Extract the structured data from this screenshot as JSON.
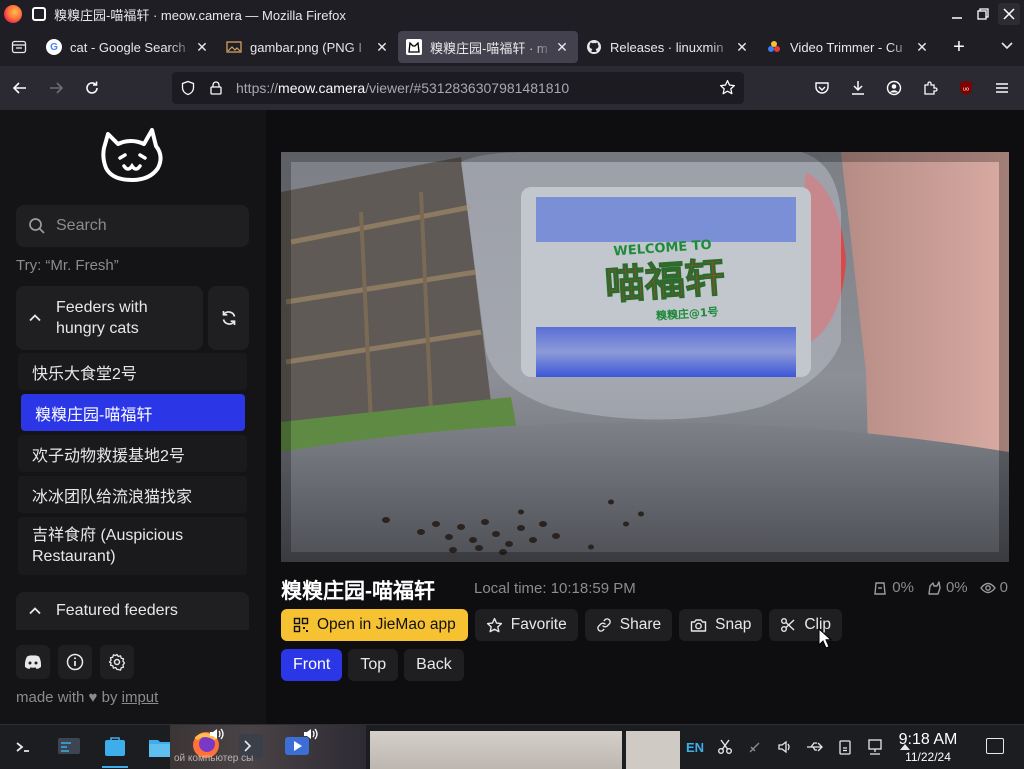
{
  "window": {
    "title": "糗糗庄园-喵福轩 · meow.camera — Mozilla Firefox"
  },
  "tabs": [
    {
      "label": "cat - Google Search",
      "favicon": "google-icon",
      "active": false
    },
    {
      "label": "gambar.png (PNG I",
      "favicon": "image-icon",
      "active": false
    },
    {
      "label": "糗糗庄园-喵福轩 · m",
      "favicon": "meow-camera-icon",
      "active": true
    },
    {
      "label": "Releases · linuxmin",
      "favicon": "github-icon",
      "active": false
    },
    {
      "label": "Video Trimmer - Cu",
      "favicon": "colorful-dots-icon",
      "active": false
    }
  ],
  "urlbar": {
    "prefix": "https://",
    "host": "meow.camera",
    "path": "/viewer/#5312836307981481810"
  },
  "sidebar": {
    "search_placeholder": "Search",
    "search_hint": "Try: “Mr. Fresh”",
    "feeders_header": "Feeders with hungry cats",
    "feeders": [
      {
        "label": "快乐大食堂2号",
        "active": false
      },
      {
        "label": "糗糗庄园-喵福轩",
        "active": true
      },
      {
        "label": "欢子动物救援基地2号",
        "active": false
      },
      {
        "label": "冰冰团队给流浪猫找家",
        "active": false
      },
      {
        "label": "吉祥食府 (Auspicious Restaurant)",
        "active": false
      }
    ],
    "featured_header": "Featured feeders",
    "made_with_prefix": "made with",
    "made_with_by": "by",
    "made_with_link": "imput"
  },
  "viewer": {
    "camera_title": "糗糗庄园-喵福轩",
    "local_time": "Local time: 10:18:59 PM",
    "stats": {
      "food": "0%",
      "cats": "0%",
      "viewers": "0"
    },
    "sign_welcome": "WELCOME TO",
    "sign_main": "喵福轩",
    "sign_sub": "糗糗庄@1号",
    "actions": {
      "open_app": "Open in JieMao app",
      "favorite": "Favorite",
      "share": "Share",
      "snap": "Snap",
      "clip": "Clip"
    },
    "views": [
      {
        "label": "Front",
        "active": true
      },
      {
        "label": "Top",
        "active": false
      },
      {
        "label": "Back",
        "active": false
      }
    ]
  },
  "taskbar": {
    "thumb_text": "ой компьютер сы",
    "clock_time": "9:18 AM",
    "clock_date": "11/22/24"
  },
  "colors": {
    "accent_blue": "#2b37e6",
    "accent_yellow": "#f6c232",
    "page_bg": "#0e0e10",
    "browser_chrome": "#1f1e25"
  }
}
